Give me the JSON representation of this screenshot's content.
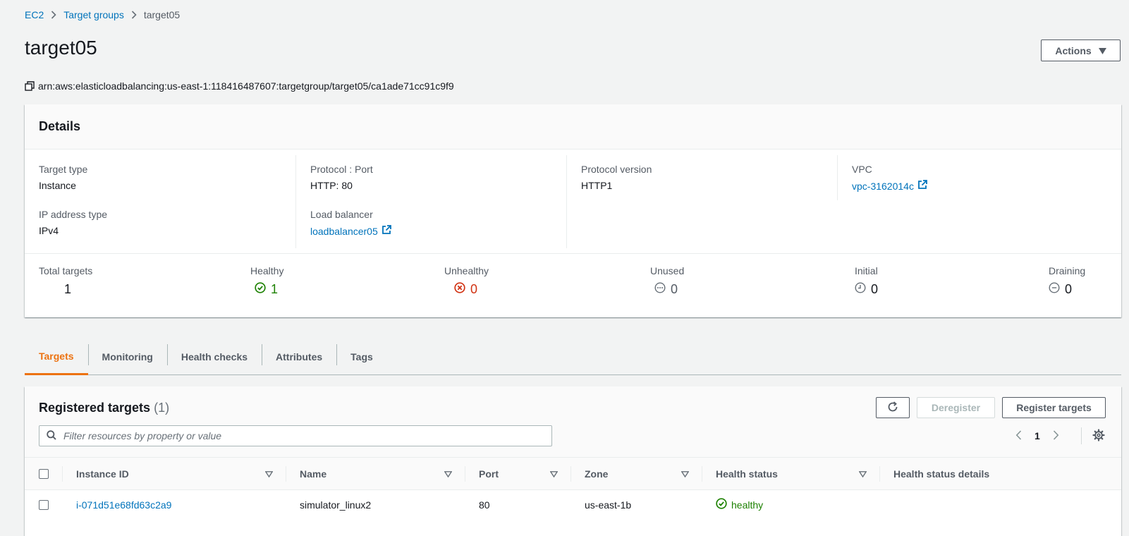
{
  "breadcrumb": {
    "items": [
      "EC2",
      "Target groups"
    ],
    "current": "target05"
  },
  "page": {
    "title": "target05",
    "actions_label": "Actions"
  },
  "arn": "arn:aws:elasticloadbalancing:us-east-1:118416487607:targetgroup/target05/ca1ade71cc91c9f9",
  "details": {
    "title": "Details",
    "target_type": {
      "label": "Target type",
      "value": "Instance"
    },
    "ip_address_type": {
      "label": "IP address type",
      "value": "IPv4"
    },
    "protocol_port": {
      "label": "Protocol : Port",
      "value": "HTTP: 80"
    },
    "load_balancer": {
      "label": "Load balancer",
      "value": "loadbalancer05"
    },
    "protocol_version": {
      "label": "Protocol version",
      "value": "HTTP1"
    },
    "vpc": {
      "label": "VPC",
      "value": "vpc-3162014c"
    }
  },
  "counts": {
    "total": {
      "label": "Total targets",
      "value": "1"
    },
    "healthy": {
      "label": "Healthy",
      "value": "1"
    },
    "unhealthy": {
      "label": "Unhealthy",
      "value": "0"
    },
    "unused": {
      "label": "Unused",
      "value": "0"
    },
    "initial": {
      "label": "Initial",
      "value": "0"
    },
    "draining": {
      "label": "Draining",
      "value": "0"
    }
  },
  "tabs": [
    "Targets",
    "Monitoring",
    "Health checks",
    "Attributes",
    "Tags"
  ],
  "registered": {
    "title": "Registered targets",
    "count": "(1)",
    "deregister_label": "Deregister",
    "register_label": "Register targets",
    "search_placeholder": "Filter resources by property or value",
    "page_number": "1",
    "columns": [
      "Instance ID",
      "Name",
      "Port",
      "Zone",
      "Health status",
      "Health status details"
    ],
    "rows": [
      {
        "instance_id": "i-071d51e68fd63c2a9",
        "name": "simulator_linux2",
        "port": "80",
        "zone": "us-east-1b",
        "health_status": "healthy",
        "health_status_details": ""
      }
    ]
  },
  "colors": {
    "link": "#0073bb",
    "accent": "#ec7211",
    "healthy": "#1d8102",
    "unhealthy": "#d13212",
    "muted": "#687078"
  }
}
